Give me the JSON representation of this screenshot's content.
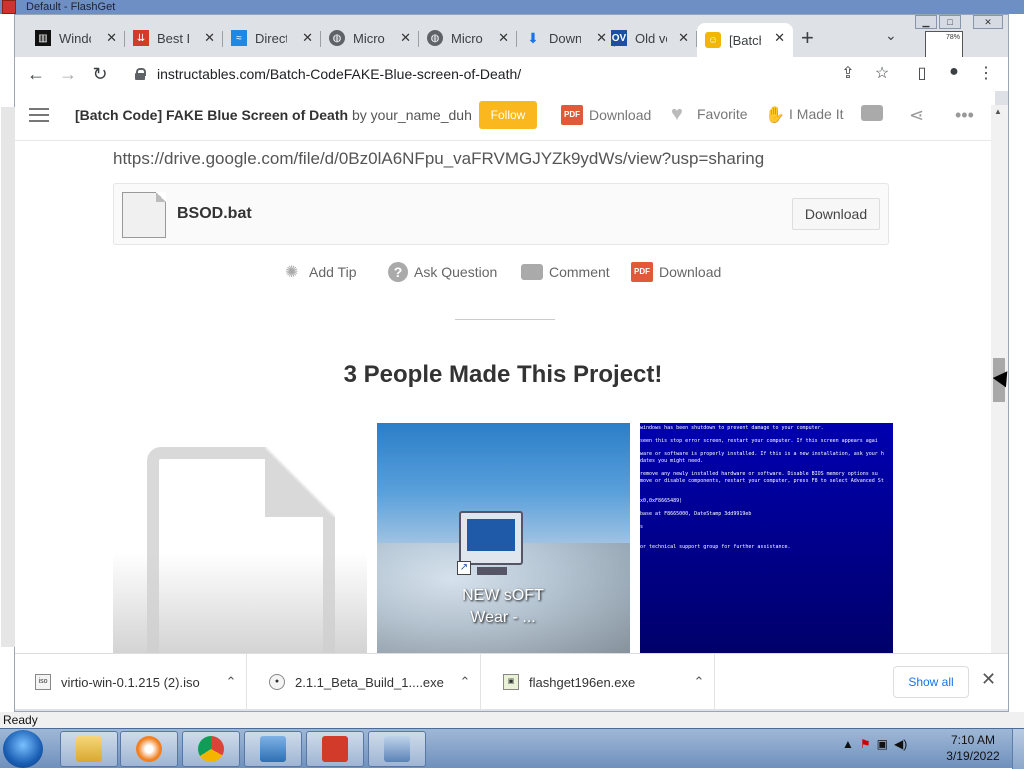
{
  "app_window": {
    "title": "Default - FlashGet"
  },
  "browser": {
    "tabs": [
      {
        "label": "Windo",
        "icon": "museum-icon",
        "color": "#111111"
      },
      {
        "label": "Best D",
        "icon": "download-arrow-icon",
        "color": "#d23a2a"
      },
      {
        "label": "Direct",
        "icon": "wave-icon",
        "color": "#1e88e5"
      },
      {
        "label": "Micro",
        "icon": "globe-icon",
        "color": "#5f6368"
      },
      {
        "label": "Micro",
        "icon": "globe-icon",
        "color": "#5f6368"
      },
      {
        "label": "Down",
        "icon": "download-icon",
        "color": "#1a73e8"
      },
      {
        "label": "Old ve",
        "icon": "ov-icon",
        "color": "#1d4fa0"
      },
      {
        "label": "[Batch",
        "icon": "robot-icon",
        "color": "#f2b705",
        "active": true
      }
    ],
    "zoom_thumb": "78%",
    "url": "instructables.com/Batch-CodeFAKE-Blue-screen-of-Death/"
  },
  "header": {
    "title": "[Batch Code] FAKE Blue Screen of Death",
    "by": "by your_name_duh",
    "follow": "Follow",
    "download": "Download",
    "favorite": "Favorite",
    "made_it": "I Made It",
    "pdf_badge": "PDF"
  },
  "content": {
    "drive_link": "https://drive.google.com/file/d/0Bz0lA6NFpu_vaFRVMGJYZk9ydWs/view?usp=sharing",
    "file_name": "BSOD.bat",
    "file_download": "Download",
    "actions": {
      "add_tip": "Add Tip",
      "ask_question": "Ask Question",
      "comment": "Comment",
      "download": "Download"
    },
    "made_title": "3 People Made This Project!",
    "gallery_label_1": "NEW sOFT",
    "gallery_label_2": "Wear - ...",
    "bsod_text": "windows has been shutdown to prevent damage to your computer.\n\nseen this stop error screen, restart your computer. If this screen appears agai\n\nware or software is properly installed. If this is a new installation, ask your h\ndates you might need.\n\nremove any newly installed hardware or software. Disable BIOS memory options su\nmove or disable components, restart your computer, press F8 to select Advanced St\n\n\nx0,0xF8665489)\n\nbase at F8665000, DateStamp 3dd9919eb\n\ns\n\n\nor technical support group for further assistance."
  },
  "downloads": {
    "items": [
      {
        "name": "virtio-win-0.1.215 (2).iso",
        "icon": "iso"
      },
      {
        "name": "2.1.1_Beta_Build_1....exe",
        "icon": "exe"
      },
      {
        "name": "flashget196en.exe",
        "icon": "exe"
      }
    ],
    "show_all": "Show all"
  },
  "status_bar": {
    "text": "Ready"
  },
  "taskbar": {
    "time": "7:10 AM",
    "date": "3/19/2022"
  }
}
